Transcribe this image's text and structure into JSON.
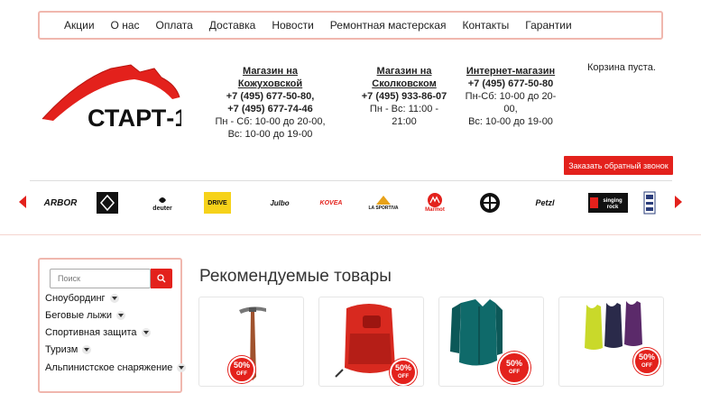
{
  "nav": {
    "items": [
      "Акции",
      "О нас",
      "Оплата",
      "Доставка",
      "Новости",
      "Ремонтная мастерская",
      "Контакты",
      "Гарантии"
    ]
  },
  "logo": {
    "text": "СТАРТ-1"
  },
  "stores": [
    {
      "name": "Магазин на Кожуховской",
      "phones": [
        "+7 (495) 677-50-80,",
        "+7 (495) 677-74-46"
      ],
      "hours": [
        "Пн - Сб: 10-00 до 20-00,",
        "Вс: 10-00 до 19-00"
      ]
    },
    {
      "name": "Магазин на",
      "name2": "Сколковском",
      "phones": [
        "+7 (495) 933-86-07"
      ],
      "hours": [
        "Пн - Вс: 11:00 - 21:00"
      ]
    },
    {
      "name": "Интернет-магазин",
      "phones": [
        "+7 (495) 677-50-80"
      ],
      "hours": [
        "Пн-Сб: 10-00 до 20-00,",
        "Вс: 10-00 до 19-00"
      ]
    }
  ],
  "cart": {
    "text": "Корзина пуста."
  },
  "callback": {
    "label": "Заказать обратный звонок"
  },
  "brands": [
    "ARBOR",
    "Black Diamond",
    "deuter",
    "DRIVE",
    "Julbo",
    "KOVEA",
    "LA SPORTIVA",
    "Marmot",
    "MSR",
    "Petzl",
    "singing rock",
    "VAUDE"
  ],
  "search": {
    "placeholder": "Поиск"
  },
  "categories": [
    "Сноубординг",
    "Беговые лыжи",
    "Спортивная защита",
    "Туризм",
    "Альпинистское снаряжение"
  ],
  "main": {
    "heading": "Рекомендуемые товары"
  },
  "products": [
    {
      "item": "ice-axe",
      "badge_pct": "50%",
      "badge_off": "OFF"
    },
    {
      "item": "red-backpack",
      "badge_pct": "50%",
      "badge_off": "OFF"
    },
    {
      "item": "teal-jacket",
      "badge_pct": "50%",
      "badge_off": "OFF"
    },
    {
      "item": "tank-tops",
      "badge_pct": "50%",
      "badge_off": "OFF"
    }
  ],
  "colors": {
    "accent": "#e3211c",
    "border": "#f0b7ae"
  }
}
